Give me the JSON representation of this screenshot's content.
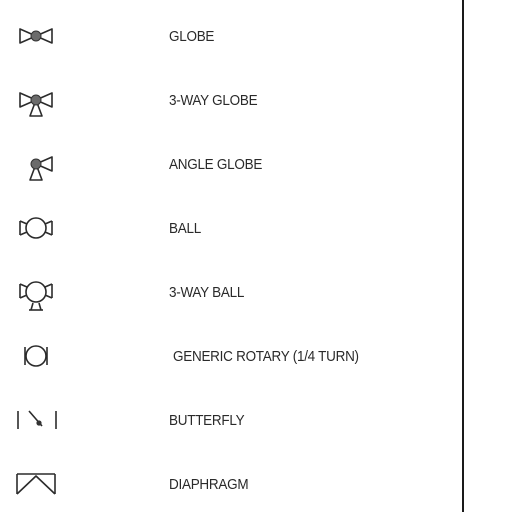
{
  "symbols": [
    {
      "icon": "globe-valve-icon",
      "label": "GLOBE"
    },
    {
      "icon": "three-way-globe-valve-icon",
      "label": "3-WAY GLOBE"
    },
    {
      "icon": "angle-globe-valve-icon",
      "label": "ANGLE GLOBE"
    },
    {
      "icon": "ball-valve-icon",
      "label": "BALL"
    },
    {
      "icon": "three-way-ball-valve-icon",
      "label": "3-WAY BALL"
    },
    {
      "icon": "generic-rotary-valve-icon",
      "label": "GENERIC ROTARY (1/4 TURN)"
    },
    {
      "icon": "butterfly-valve-icon",
      "label": "BUTTERFLY"
    },
    {
      "icon": "diaphragm-valve-icon",
      "label": "DIAPHRAGM"
    }
  ]
}
